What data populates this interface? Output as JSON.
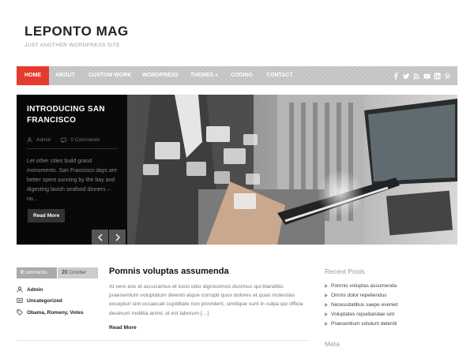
{
  "header": {
    "site_title": "LEPONTO MAG",
    "tagline": "JUST ANOTHER WORDPRESS SITE"
  },
  "nav": {
    "items": [
      {
        "label": "HOME",
        "active": true
      },
      {
        "label": "ABOUT"
      },
      {
        "label": "CUSTOM WORK"
      },
      {
        "label": "WORDPRESS"
      },
      {
        "label": "THEMES »"
      },
      {
        "label": "CODING"
      },
      {
        "label": "CONTACT"
      }
    ],
    "social_icons": [
      "facebook-icon",
      "twitter-icon",
      "rss-icon",
      "youtube-icon",
      "linkedin-icon",
      "pinterest-icon"
    ],
    "accent_color": "#e53b2c"
  },
  "slider": {
    "title": "INTRODUCING SAN FRANCISCO",
    "author": "Admin",
    "comments": "0 Comments",
    "excerpt": "Let other cities build grand monuments. San Francisco days are better spent sunning by the bay and digesting lavish seafood dinners – no...",
    "read_more": "Read More",
    "prev_icon": "chevron-left-icon",
    "next_icon": "chevron-right-icon"
  },
  "post": {
    "comments_count": "0",
    "comments_label": "comments",
    "day": "20",
    "month": "October",
    "author": "Admin",
    "category": "Uncategorized",
    "tags": "Obama, Romeny, Votes",
    "title": "Pomnis voluptas assumenda",
    "excerpt": "At vero eos et accusamus et iusto odio dignissimos ducimus qui blanditiis praesentium voluptatum deleniti atque corrupti quos dolores et quas molestias excepturi sint occaecati cupiditate non provident, similique sunt in culpa qui officia deserunt mollitia animi, id est laborum […]",
    "read_more": "Read More"
  },
  "sidebar": {
    "recent_posts_title": "Recent Posts",
    "recent_posts": [
      "Pomnis voluptas assumenda",
      "Omnis dolor repellendus",
      "Necessitatibus saepe eveniet",
      "Voluptates repudiandae sint",
      "Praesentium volutum deleniti"
    ],
    "meta_title": "Meta"
  }
}
